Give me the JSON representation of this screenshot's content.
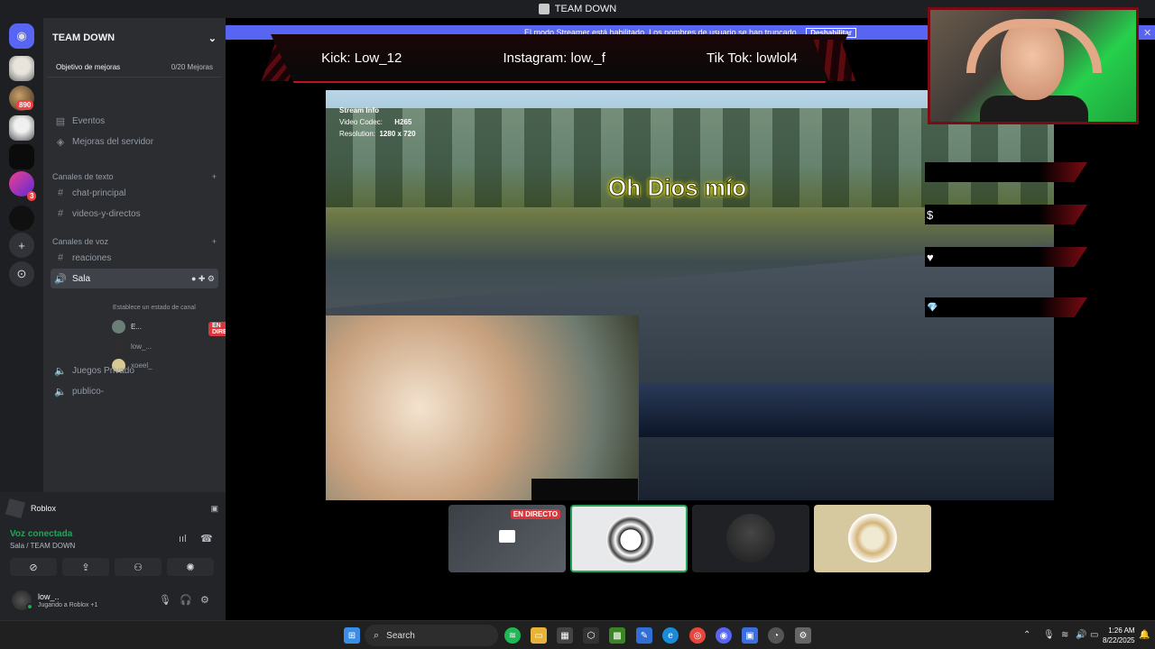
{
  "window": {
    "title": "TEAM DOWN"
  },
  "servers": {
    "badge1": "890",
    "badge2": "3"
  },
  "guild": {
    "name": "TEAM DOWN",
    "boost_label": "Objetivo de mejoras",
    "boost_count": "0/20 Mejoras",
    "events": "Eventos",
    "server_boosts": "Mejoras del servidor",
    "text_category": "Canales de texto",
    "text_channels": [
      "chat-principal",
      "videos-y-directos"
    ],
    "voice_category": "Canales de voz",
    "voice_channels": {
      "reaciones": "reaciones",
      "sala": "Sala",
      "sala_status": "Establece un estado de canal",
      "users": [
        "E...",
        "low_...",
        "xoeel_"
      ],
      "live_label": "EN DIRECTO",
      "juegos": "Juegos Privado",
      "publico": "publico-"
    }
  },
  "activity": {
    "game": "Roblox"
  },
  "voice": {
    "status": "Voz conectada",
    "location": "Sala / TEAM DOWN"
  },
  "user": {
    "name": "low_..",
    "status": "Jugando a Roblox +1"
  },
  "stream": {
    "banner_text": "El modo Streamer está habilitado. Los nombres de usuario se han truncado.",
    "banner_button": "Deshabilitar",
    "socials": [
      "Kick: Low_12",
      "Instagram: low._f",
      "Tik Tok: lowlol4"
    ],
    "info_title": "Stream Info",
    "codec_label": "Video Codec:",
    "codec_value": "H265",
    "res_label": "Resolution:",
    "res_value": "1280 x 720",
    "caption": "Oh Dios mío",
    "hud_icons": [
      "$",
      "♥",
      "💎"
    ],
    "tile_live": "EN DIRECTO"
  },
  "taskbar": {
    "search": "Search",
    "time": "1:26 AM",
    "date": "8/22/2025"
  },
  "colors": {
    "accent": "#5865f2",
    "live": "#da373c",
    "online": "#23a55a",
    "brand_red": "#c2121f"
  }
}
